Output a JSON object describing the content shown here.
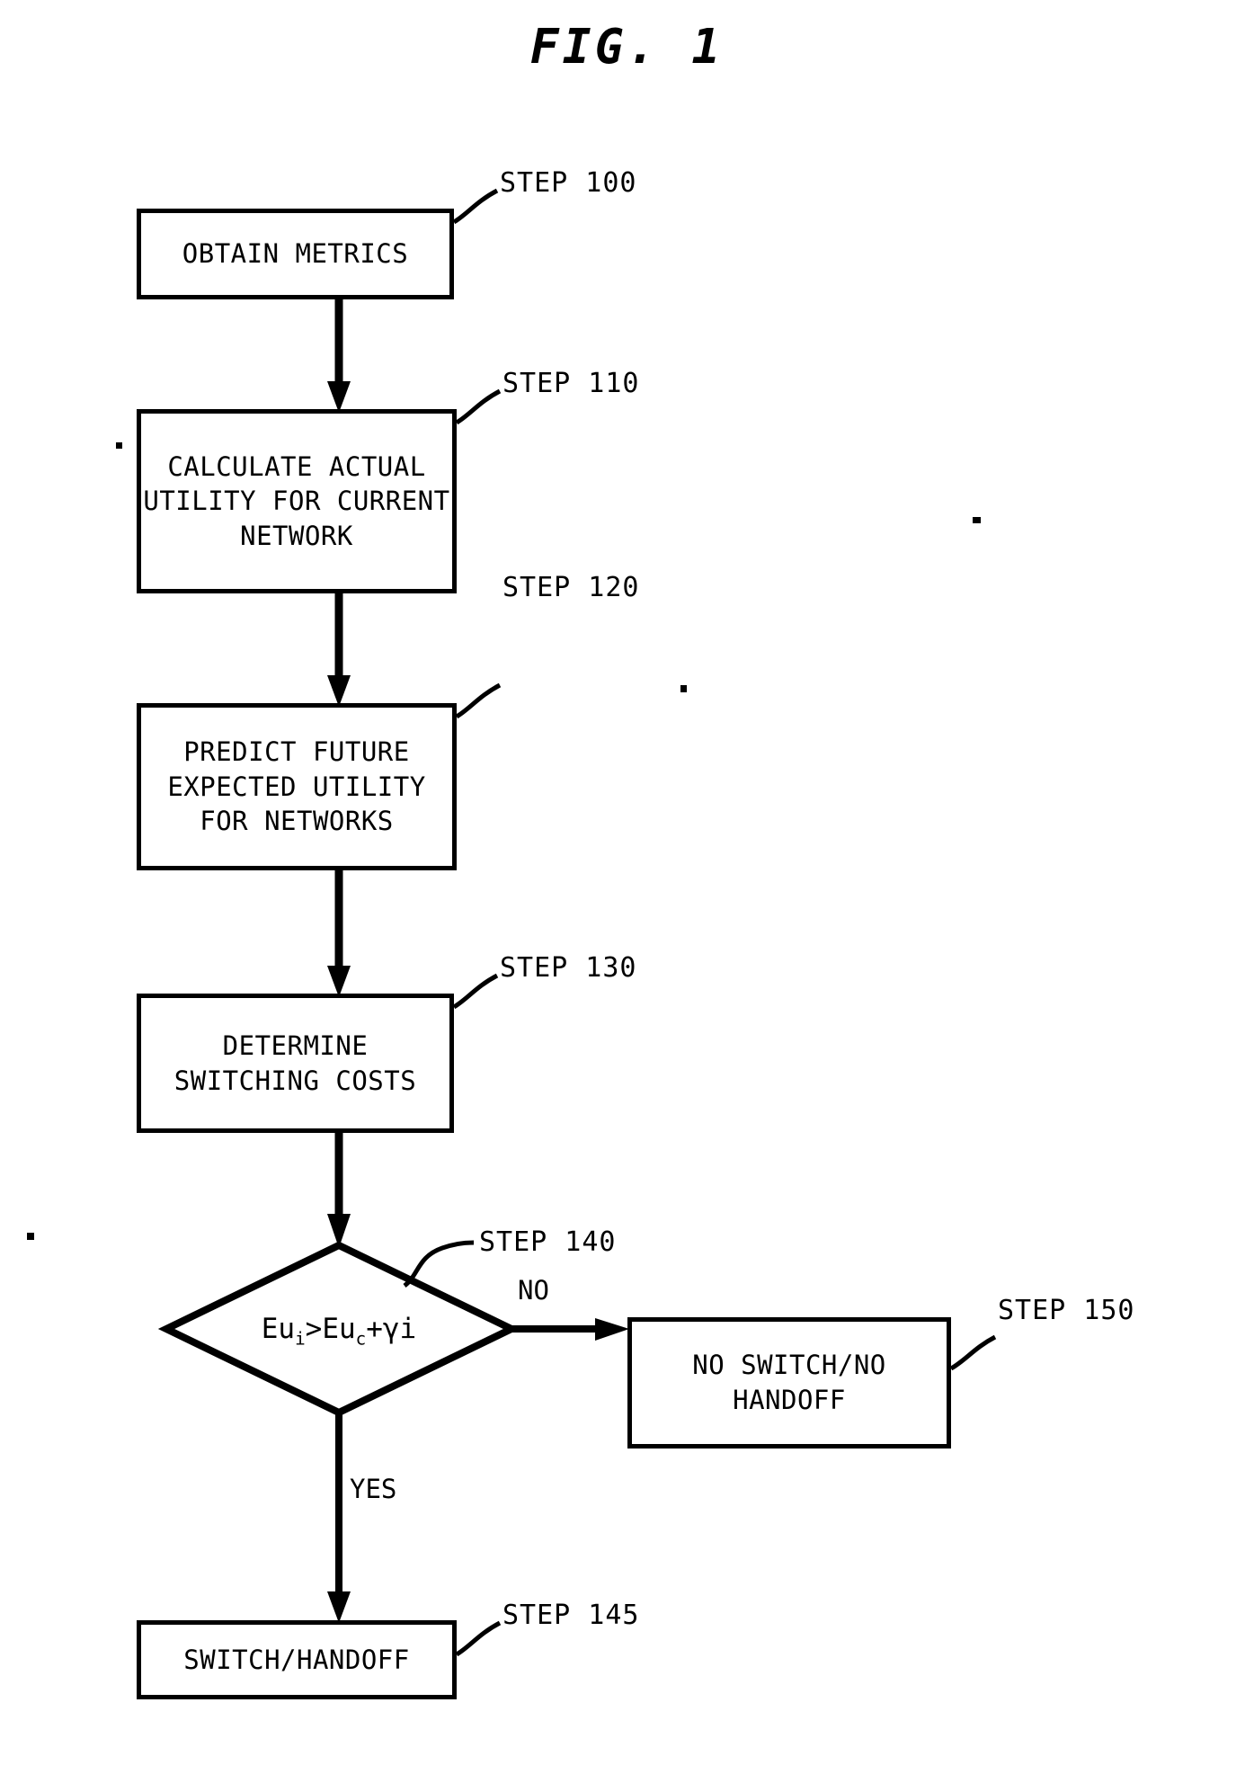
{
  "figure": {
    "title": "FIG. 1",
    "kind": "flowchart",
    "ink_color": "#000000",
    "background_color": "#ffffff"
  },
  "nodes": [
    {
      "id": "step100",
      "shape": "process",
      "text": "OBTAIN METRICS",
      "step_label": "STEP 100"
    },
    {
      "id": "step110",
      "shape": "process",
      "text": "CALCULATE ACTUAL\nUTILITY FOR CURRENT\nNETWORK",
      "step_label": "STEP 110"
    },
    {
      "id": "step120",
      "shape": "process",
      "text": "PREDICT FUTURE\nEXPECTED UTILITY\nFOR NETWORKS",
      "step_label": "STEP 120"
    },
    {
      "id": "step130",
      "shape": "process",
      "text": "DETERMINE\nSWITCHING COSTS",
      "step_label": "STEP 130"
    },
    {
      "id": "step140",
      "shape": "decision",
      "expression_prefix": "Eu",
      "expression_sub1": "i",
      "expression_middle": ">Eu",
      "expression_sub2": "c",
      "expression_suffix": "+γi",
      "expression_plain": "Eu_i>Eu_c+γi",
      "step_label": "STEP 140"
    },
    {
      "id": "step150",
      "shape": "process",
      "text": "NO SWITCH/NO\nHANDOFF",
      "step_label": "STEP 150"
    },
    {
      "id": "step145",
      "shape": "process",
      "text": "SWITCH/HANDOFF",
      "step_label": "STEP 145"
    }
  ],
  "edges": [
    {
      "from": "step100",
      "to": "step110",
      "label": ""
    },
    {
      "from": "step110",
      "to": "step120",
      "label": ""
    },
    {
      "from": "step120",
      "to": "step130",
      "label": ""
    },
    {
      "from": "step130",
      "to": "step140",
      "label": ""
    },
    {
      "from": "step140",
      "to": "step150",
      "label": "NO"
    },
    {
      "from": "step140",
      "to": "step145",
      "label": "YES"
    }
  ],
  "branch_labels": {
    "no": "NO",
    "yes": "YES"
  }
}
